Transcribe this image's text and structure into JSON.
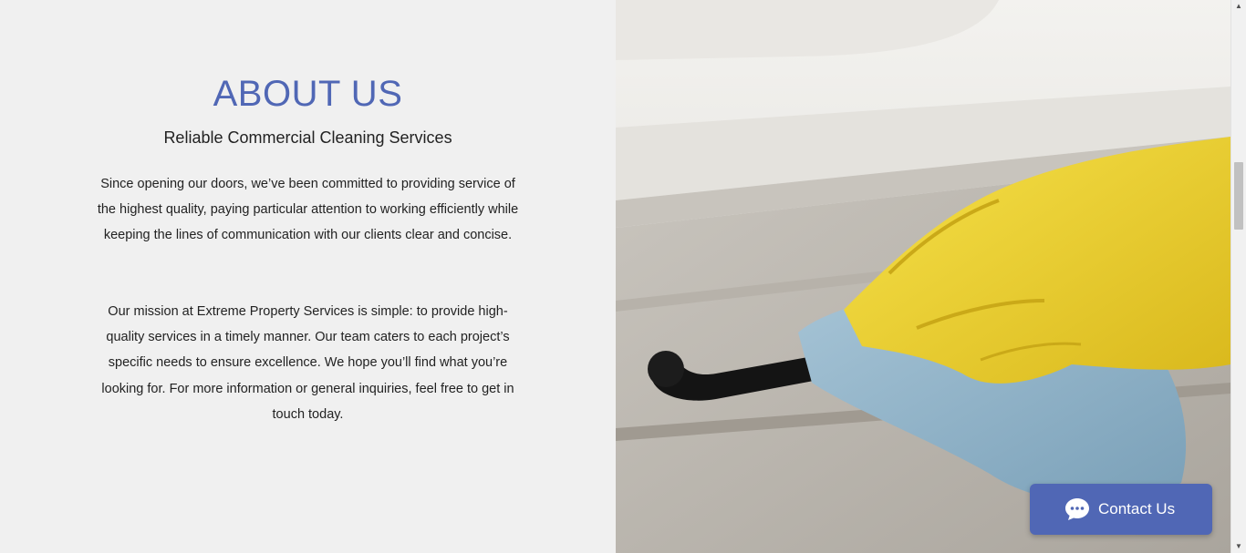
{
  "about": {
    "title": "ABOUT US",
    "subtitle": "Reliable Commercial Cleaning Services",
    "paragraph_1": "Since opening our doors, we’ve been committed to providing service of the highest quality, paying particular attention to working efficiently while keeping the lines of communication with our clients clear and concise.",
    "paragraph_2": "Our mission at Extreme Property Services is simple: to provide high-quality services in a timely manner. Our team caters to each project’s specific needs to ensure excellence. We hope you’ll find what you’re looking for. For more information or general inquiries, feel free to get in touch today."
  },
  "photo": {
    "icon": "cleaning-photo"
  },
  "contact_widget": {
    "label": "Contact Us",
    "icon": "chat-bubble-icon"
  },
  "scrollbar": {
    "up_icon": "scroll-up-arrow",
    "down_icon": "scroll-down-arrow"
  },
  "colors": {
    "accent": "#5067b5",
    "background": "#f0f0f0",
    "text": "#222222",
    "glove": "#f1d22e",
    "cloth": "#8eb4cc"
  }
}
